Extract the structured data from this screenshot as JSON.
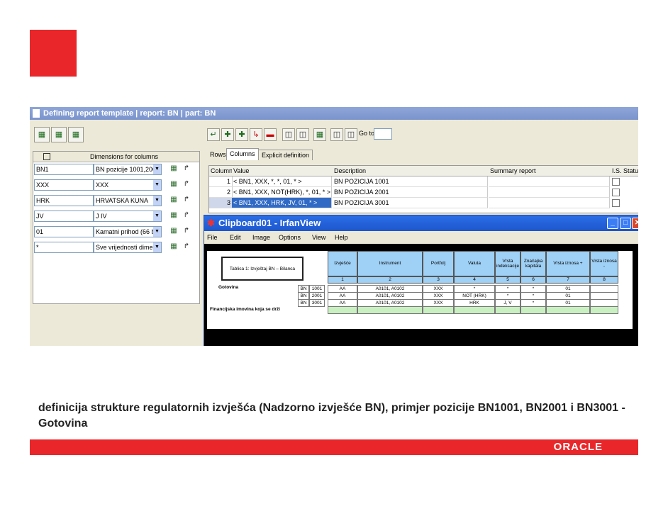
{
  "window": {
    "title": "Defining report template | report: BN | part: BN"
  },
  "toolbar": {
    "goto_label": "Go to:",
    "goto_value": ""
  },
  "dimensions": {
    "header": "Dimensions for columns",
    "rows": [
      {
        "code": "BN1",
        "value": "BN pozicije 1001,200"
      },
      {
        "code": "XXX",
        "value": "XXX"
      },
      {
        "code": "HRK",
        "value": "HRVATSKA KUNA"
      },
      {
        "code": "JV",
        "value": "J IV"
      },
      {
        "code": "01",
        "value": "Kamatni prihod (66 bi"
      },
      {
        "code": "*",
        "value": "Sve vrijednosti dimen"
      }
    ]
  },
  "tabs": [
    {
      "label": "Rows"
    },
    {
      "label": "Columns"
    },
    {
      "label": "Explicit definition"
    }
  ],
  "grid": {
    "headers": [
      "Column",
      "Value",
      "Description",
      "Summary report",
      "I.S.",
      "Status"
    ],
    "rows": [
      {
        "num": "1",
        "value": "< BN1, XXX, *, *, 01, * >",
        "description": "BN POZICIJA 1001"
      },
      {
        "num": "2",
        "value": "< BN1, XXX, NOT(HRK), *, 01, * >",
        "description": "BN POZICIJA 2001"
      },
      {
        "num": "3",
        "value": "< BN1, XXX, HRK, JV, 01, * >",
        "description": "BN POZICIJA 3001"
      }
    ]
  },
  "irfanview": {
    "title": "Clipboard01 - IrfanView",
    "menu": [
      "File",
      "Edit",
      "Image",
      "Options",
      "View",
      "Help"
    ],
    "table_title": "Tablica 1: Izvještaj BN – Bilanca",
    "headers": [
      "Izvješće",
      "Instrument",
      "Portfolj",
      "Valuta",
      "Vrsta indeksacije",
      "Značajka kapitala",
      "Vrsta iznosa +",
      "Vrsta iznosa -"
    ],
    "numbers": [
      "1",
      "2",
      "3",
      "4",
      "5",
      "6",
      "7",
      "8"
    ],
    "section_label": "Gotovina",
    "rows": [
      {
        "bn": "BN",
        "code": "1001",
        "cells": [
          "AA",
          "A0101, A0102",
          "XXX",
          "*",
          "*",
          "*",
          "01",
          ""
        ]
      },
      {
        "bn": "BN",
        "code": "2001",
        "cells": [
          "AA",
          "A0101, A0102",
          "XXX",
          "NOT (HRK)",
          "*",
          "*",
          "01",
          ""
        ]
      },
      {
        "bn": "BN",
        "code": "3001",
        "cells": [
          "AA",
          "A0101, A0102",
          "XXX",
          "HRK",
          "J, V",
          "*",
          "01",
          ""
        ]
      }
    ],
    "footer_label": "Financijska imovina koja se drži"
  },
  "caption": "definicija strukture regulatornih izvješća (Nadzorno izvješće BN), primjer pozicije BN1001, BN2001 i BN3001 - Gotovina",
  "brand": {
    "logo": "ORACLE",
    "color": "#e9272a"
  }
}
